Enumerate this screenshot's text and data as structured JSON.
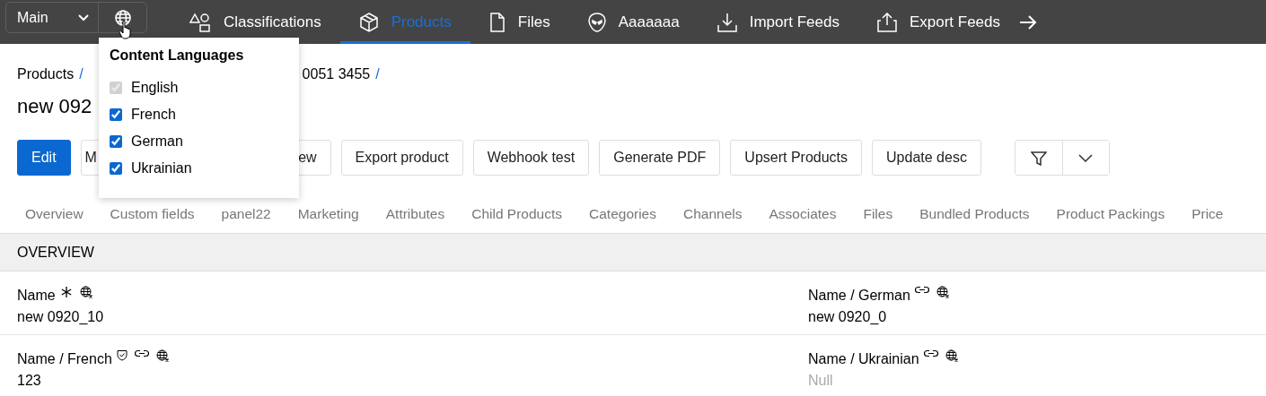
{
  "navbar": {
    "scope": {
      "value": "Main"
    },
    "items": [
      {
        "label": "Classifications",
        "selected": false
      },
      {
        "label": "Products",
        "selected": true
      },
      {
        "label": "Files",
        "selected": false
      },
      {
        "label": "Aaaaaaa",
        "selected": false
      },
      {
        "label": "Import Feeds",
        "selected": false
      },
      {
        "label": "Export Feeds",
        "selected": false
      }
    ]
  },
  "language_menu": {
    "title": "Content Languages",
    "languages": [
      {
        "label": "English",
        "checked": true,
        "disabled": true
      },
      {
        "label": "French",
        "checked": true,
        "disabled": false
      },
      {
        "label": "German",
        "checked": true,
        "disabled": false
      },
      {
        "label": "Ukrainian",
        "checked": true,
        "disabled": false
      }
    ]
  },
  "breadcrumb": [
    {
      "label": "Products",
      "separator": "/"
    },
    {
      "label": "0051 3455",
      "separator": "/"
    }
  ],
  "title": "new 092",
  "actions": [
    {
      "label": "Edit",
      "kind": "primary"
    },
    {
      "label": "M",
      "kind": "cut-left"
    },
    {
      "label": "ew",
      "kind": "cut-right"
    },
    {
      "label": "Export product",
      "kind": "plain"
    },
    {
      "label": "Webhook test",
      "kind": "plain"
    },
    {
      "label": "Generate PDF",
      "kind": "plain"
    },
    {
      "label": "Upsert Products",
      "kind": "plain"
    },
    {
      "label": "Update desc",
      "kind": "plain"
    }
  ],
  "panels": [
    "Overview",
    "Custom fields",
    "panel22",
    "Marketing",
    "Attributes",
    "Child Products",
    "Categories",
    "Channels",
    "Associates",
    "Files",
    "Bundled Products",
    "Product Packings",
    "Price"
  ],
  "section": {
    "title": "OVERVIEW"
  },
  "fields": [
    {
      "label": "Name",
      "value": "new 0920_10",
      "required": true,
      "protected": false,
      "linked": false,
      "empty": false
    },
    {
      "label": "Name / German",
      "value": "new 0920_0",
      "required": false,
      "protected": false,
      "linked": true,
      "empty": false
    },
    {
      "label": "Name / French",
      "value": "123",
      "required": false,
      "protected": true,
      "linked": true,
      "empty": false
    },
    {
      "label": "Name / Ukrainian",
      "value": "Null",
      "required": false,
      "protected": false,
      "linked": true,
      "empty": true
    }
  ]
}
